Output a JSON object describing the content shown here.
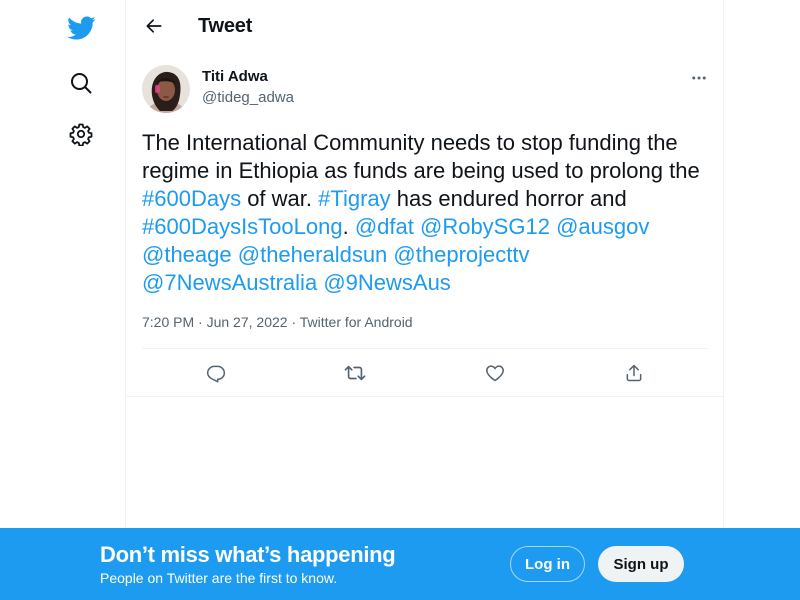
{
  "colors": {
    "accent": "#1d9bf0",
    "text": "#0f1419",
    "secondary": "#536471",
    "border": "#eff3f4"
  },
  "nav": {
    "logo_icon": "twitter-bird-icon",
    "explore_icon": "search-icon",
    "settings_icon": "gear-icon"
  },
  "header": {
    "back_icon": "arrow-left-icon",
    "title": "Tweet"
  },
  "tweet": {
    "author": {
      "name": "Titi Adwa",
      "handle": "@tideg_adwa"
    },
    "more_icon": "more-horizontal-icon",
    "text_segments": [
      {
        "text": "The International Community needs to stop funding the regime in Ethiopia as funds are being used to prolong the ",
        "link": false
      },
      {
        "text": "#600Days",
        "link": true
      },
      {
        "text": " of war. ",
        "link": false
      },
      {
        "text": "#Tigray",
        "link": true
      },
      {
        "text": " has endured horror and ",
        "link": false
      },
      {
        "text": "#600DaysIsTooLong",
        "link": true
      },
      {
        "text": ". ",
        "link": false
      },
      {
        "text": "@dfat",
        "link": true
      },
      {
        "text": " ",
        "link": false
      },
      {
        "text": "@RobySG12",
        "link": true
      },
      {
        "text": " ",
        "link": false
      },
      {
        "text": "@ausgov",
        "link": true
      },
      {
        "text": " ",
        "link": false
      },
      {
        "text": "@theage",
        "link": true
      },
      {
        "text": " ",
        "link": false
      },
      {
        "text": "@theheraldsun",
        "link": true
      },
      {
        "text": " ",
        "link": false
      },
      {
        "text": "@theprojecttv",
        "link": true
      },
      {
        "text": " ",
        "link": false
      },
      {
        "text": "@7NewsAustralia",
        "link": true
      },
      {
        "text": " ",
        "link": false
      },
      {
        "text": "@9NewsAus",
        "link": true
      }
    ],
    "time": "7:20 PM",
    "separator": " · ",
    "date": "Jun 27, 2022",
    "source": "Twitter for Android",
    "actions": {
      "reply_icon": "reply-icon",
      "retweet_icon": "retweet-icon",
      "like_icon": "heart-icon",
      "share_icon": "share-icon"
    }
  },
  "banner": {
    "title": "Don’t miss what’s happening",
    "subtitle": "People on Twitter are the first to know.",
    "login_label": "Log in",
    "signup_label": "Sign up"
  }
}
